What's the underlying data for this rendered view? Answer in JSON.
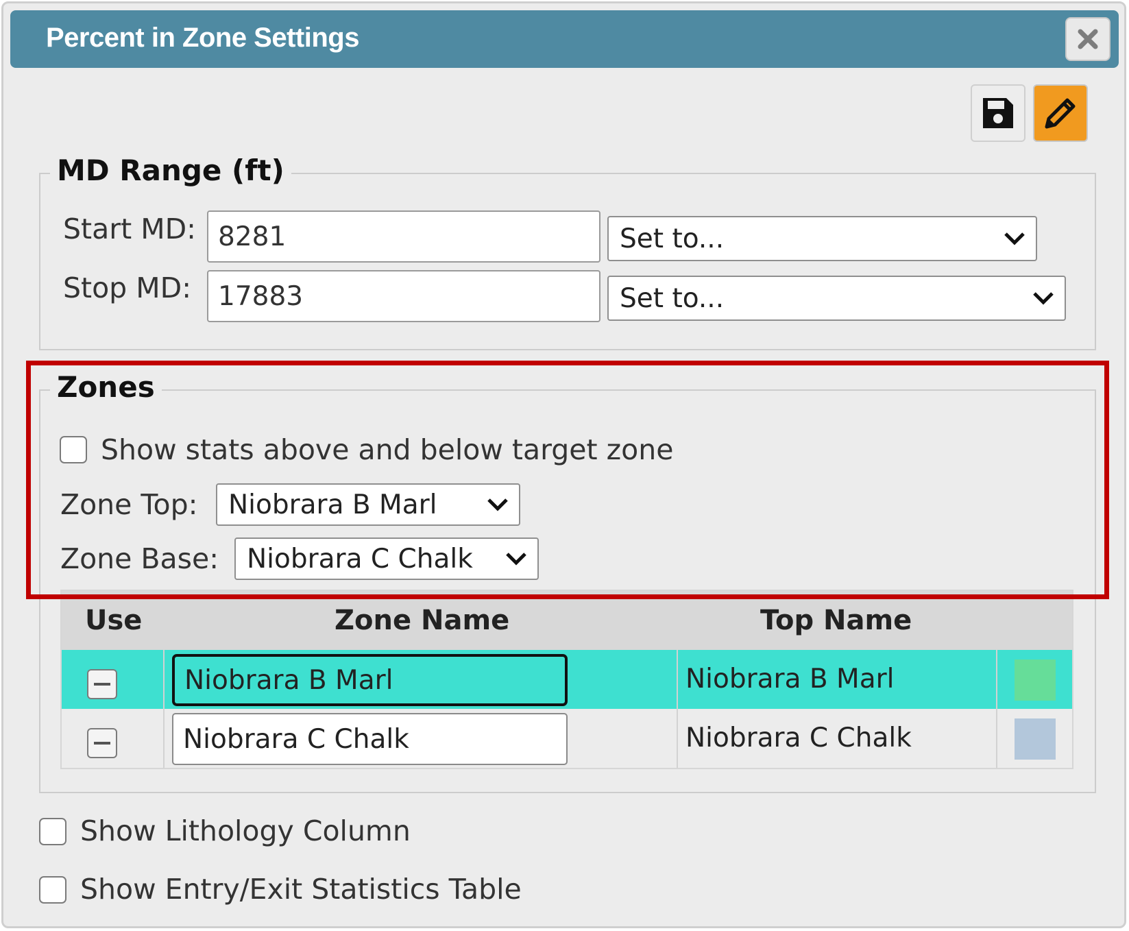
{
  "dialog": {
    "title": "Percent in Zone Settings",
    "close_icon": "close-icon",
    "toolbar": {
      "save_icon": "floppy-disk-icon",
      "edit_icon": "pencil-icon",
      "edit_active_color": "#f19a1f"
    }
  },
  "md_range": {
    "legend": "MD Range (ft)",
    "start_label": "Start MD:",
    "start_value": "8281",
    "start_select": "Set to...",
    "stop_label": "Stop MD:",
    "stop_value": "17883",
    "stop_select": "Set to..."
  },
  "zones": {
    "legend": "Zones",
    "show_stats_label": "Show stats above and below target zone",
    "show_stats_checked": false,
    "zone_top_label": "Zone Top:",
    "zone_top_value": "Niobrara B Marl",
    "zone_base_label": "Zone Base:",
    "zone_base_value": "Niobrara C Chalk",
    "table": {
      "headers": {
        "use": "Use",
        "zone_name": "Zone Name",
        "top_name": "Top Name"
      },
      "rows": [
        {
          "zone_name": "Niobrara B Marl",
          "top_name": "Niobrara B Marl",
          "color": "#66dd99",
          "selected": true
        },
        {
          "zone_name": "Niobrara C Chalk",
          "top_name": "Niobrara C Chalk",
          "color": "#b3c7db",
          "selected": false
        }
      ]
    }
  },
  "options": {
    "show_lithology_label": "Show Lithology Column",
    "show_lithology_checked": false,
    "show_entry_exit_label": "Show Entry/Exit Statistics Table",
    "show_entry_exit_checked": false
  },
  "colors": {
    "titlebar": "#4f8aa2",
    "selected_row": "#3ee0d0",
    "highlight_frame": "#c00000"
  }
}
